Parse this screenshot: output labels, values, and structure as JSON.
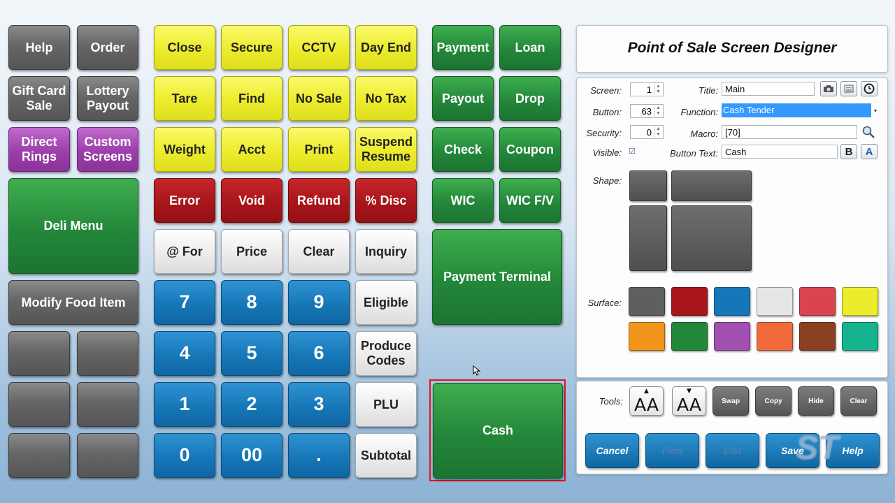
{
  "left_grid": {
    "help": "Help",
    "order": "Order",
    "gift_card_sale": "Gift Card\nSale",
    "lottery_payout": "Lottery\nPayout",
    "direct_rings": "Direct\nRings",
    "custom_screens": "Custom\nScreens",
    "deli_menu": "Deli Menu",
    "modify_food_item": "Modify Food Item"
  },
  "function_grid": {
    "close": "Close",
    "secure": "Secure",
    "cctv": "CCTV",
    "day_end": "Day End",
    "tare": "Tare",
    "find": "Find",
    "no_sale": "No Sale",
    "no_tax": "No Tax",
    "weight": "Weight",
    "acct": "Acct",
    "print": "Print",
    "suspend_resume": "Suspend\nResume",
    "error": "Error",
    "void": "Void",
    "refund": "Refund",
    "pct_disc": "% Disc",
    "at_for": "@ For",
    "price": "Price",
    "clear": "Clear",
    "inquiry": "Inquiry",
    "eligible": "Eligible",
    "produce_codes": "Produce\nCodes",
    "plu": "PLU",
    "subtotal": "Subtotal"
  },
  "keypad": {
    "k7": "7",
    "k8": "8",
    "k9": "9",
    "k4": "4",
    "k5": "5",
    "k6": "6",
    "k1": "1",
    "k2": "2",
    "k3": "3",
    "k0": "0",
    "k00": "00",
    "kdot": "."
  },
  "tender_grid": {
    "payment": "Payment",
    "loan": "Loan",
    "payout": "Payout",
    "drop": "Drop",
    "check": "Check",
    "coupon": "Coupon",
    "wic": "WIC",
    "wic_fv": "WIC F/V",
    "payment_terminal": "Payment Terminal",
    "cash": "Cash"
  },
  "designer": {
    "title": "Point of Sale Screen Designer",
    "screen_label": "Screen:",
    "screen_value": "1",
    "button_label": "Button:",
    "button_value": "63",
    "security_label": "Security:",
    "security_value": "0",
    "visible_label": "Visible:",
    "visible_check": "☑",
    "title_label": "Title:",
    "title_value": "Main",
    "function_label": "Function:",
    "function_value": "Cash Tender",
    "macro_label": "Macro:",
    "macro_value": "[70]",
    "button_text_label": "Button Text:",
    "button_text_value": "Cash",
    "bold_btn": "B",
    "font_color_btn": "A",
    "shape_label": "Shape:",
    "surface_label": "Surface:",
    "surface_colors": [
      "#5f5f5f",
      "#a8161b",
      "#1677b8",
      "#e6e6e6",
      "#d9454f",
      "#ecec2c",
      "#f0951a",
      "#23873a",
      "#a14fb0",
      "#f26a3c",
      "#8c4022",
      "#16b38f"
    ]
  },
  "tools": {
    "label": "Tools:",
    "font_up": "AA",
    "font_down": "AA",
    "swap": "Swap",
    "copy": "Copy",
    "hide": "Hide",
    "clear": "Clear"
  },
  "actions": {
    "cancel": "Cancel",
    "find": "Find",
    "edit": "Edit",
    "save": "Save",
    "help": "Help"
  },
  "watermark": "ST"
}
